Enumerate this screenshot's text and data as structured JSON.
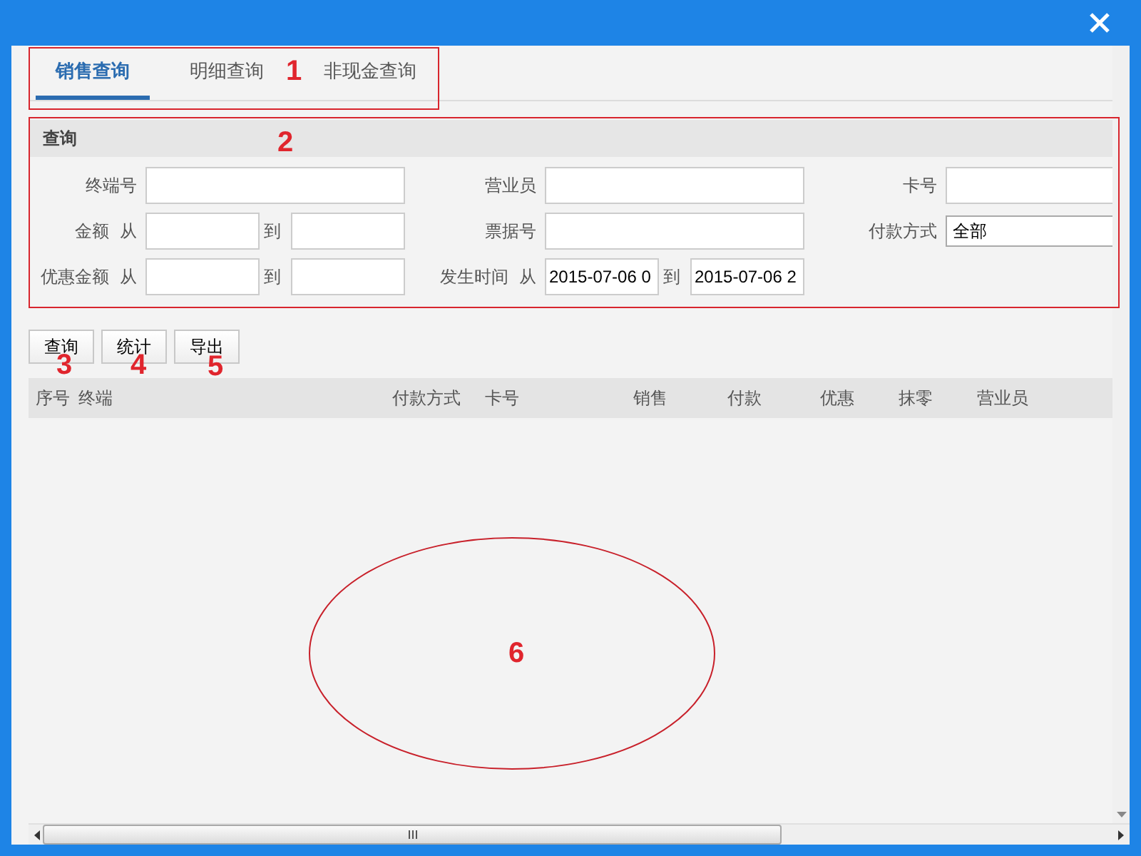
{
  "tabs": [
    {
      "label": "销售查询",
      "selected": true
    },
    {
      "label": "明细查询",
      "selected": false
    },
    {
      "label": "非现金查询",
      "selected": false
    }
  ],
  "query_panel": {
    "title": "查询",
    "rows": [
      [
        {
          "label": "终端号",
          "inputs": [
            {
              "kind": "text"
            }
          ]
        },
        {
          "label": "营业员",
          "inputs": [
            {
              "kind": "text"
            }
          ]
        },
        {
          "label": "卡号",
          "inputs": [
            {
              "kind": "text"
            }
          ]
        }
      ],
      [
        {
          "label": "金额  从",
          "inputs": [
            {
              "kind": "text"
            },
            {
              "kind": "text"
            }
          ],
          "between": "到"
        },
        {
          "label": "票据号",
          "inputs": [
            {
              "kind": "text"
            }
          ]
        },
        {
          "label": "付款方式",
          "select": "全部"
        }
      ],
      [
        {
          "label": "优惠金额  从",
          "inputs": [
            {
              "kind": "text"
            },
            {
              "kind": "text"
            }
          ],
          "between": "到"
        },
        {
          "label": "发生时间  从",
          "inputs": [
            {
              "kind": "text",
              "value": "2015-07-06 0"
            },
            {
              "kind": "text",
              "value": "2015-07-06 2"
            }
          ],
          "between": "到"
        }
      ]
    ]
  },
  "buttons": [
    "查询",
    "统计",
    "导出"
  ],
  "table": {
    "columns": [
      "序号",
      "终端",
      "付款方式",
      "卡号",
      "销售",
      "付款",
      "优惠",
      "抹零",
      "营业员"
    ]
  },
  "annotations": [
    {
      "number": "1",
      "kind": "boxed"
    },
    {
      "number": "2",
      "kind": "boxed"
    },
    {
      "number": "3",
      "kind": "plain"
    },
    {
      "number": "4",
      "kind": "plain"
    },
    {
      "number": "5",
      "kind": "plain"
    },
    {
      "number": "6",
      "kind": "circled"
    }
  ]
}
